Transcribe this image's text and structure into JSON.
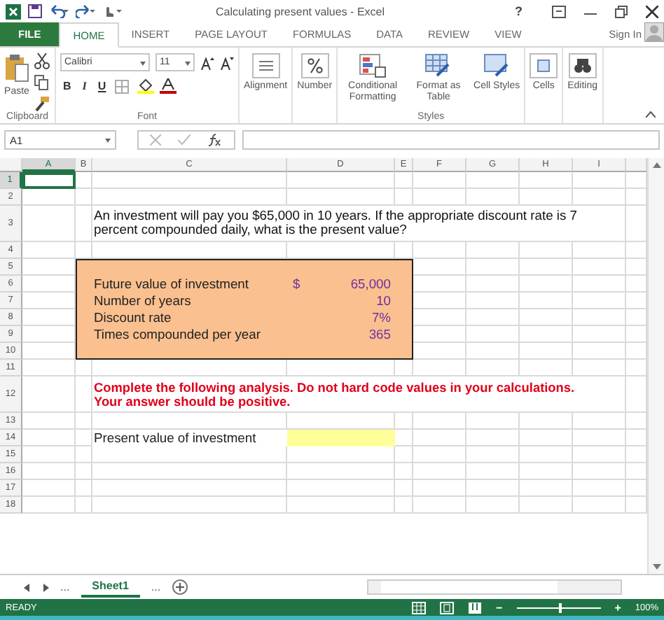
{
  "window": {
    "title": "Calculating present values - Excel",
    "help": "?",
    "sign_in": "Sign In"
  },
  "ribbon_tabs": [
    {
      "label": "FILE",
      "kind": "file",
      "selected": false
    },
    {
      "label": "HOME",
      "kind": "tab",
      "selected": true
    },
    {
      "label": "INSERT",
      "kind": "tab",
      "selected": false
    },
    {
      "label": "PAGE LAYOUT",
      "kind": "tab",
      "selected": false
    },
    {
      "label": "FORMULAS",
      "kind": "tab",
      "selected": false
    },
    {
      "label": "DATA",
      "kind": "tab",
      "selected": false
    },
    {
      "label": "REVIEW",
      "kind": "tab",
      "selected": false
    },
    {
      "label": "VIEW",
      "kind": "tab",
      "selected": false
    }
  ],
  "ribbon": {
    "clipboard": {
      "paste": "Paste",
      "label": "Clipboard"
    },
    "font": {
      "family": "Calibri",
      "size": "11",
      "format_buttons": [
        "B",
        "I",
        "U"
      ],
      "label": "Font"
    },
    "commands": [
      {
        "label": "Alignment",
        "kind": "alignment"
      },
      {
        "label": "Number",
        "kind": "number"
      }
    ],
    "styles": {
      "items": [
        {
          "label": "Conditional Formatting",
          "kind": "conditional"
        },
        {
          "label": "Format as Table",
          "kind": "table"
        },
        {
          "label": "Cell Styles",
          "kind": "cellstyles"
        }
      ],
      "label": "Styles"
    },
    "end_commands": [
      {
        "label": "Cells",
        "kind": "cells"
      },
      {
        "label": "Editing",
        "kind": "editing"
      }
    ]
  },
  "name_box": "A1",
  "sheet": {
    "columns": [
      {
        "label": "A",
        "selected": true
      },
      {
        "label": "B",
        "selected": false
      },
      {
        "label": "C",
        "selected": false
      },
      {
        "label": "D",
        "selected": false
      },
      {
        "label": "E",
        "selected": false
      },
      {
        "label": "F",
        "selected": false
      },
      {
        "label": "G",
        "selected": false
      },
      {
        "label": "H",
        "selected": false
      },
      {
        "label": "I",
        "selected": false
      }
    ],
    "rows": [
      {
        "label": "1",
        "selected": true
      },
      {
        "label": "2",
        "selected": false
      },
      {
        "label": "3",
        "selected": false
      },
      {
        "label": "4",
        "selected": false
      },
      {
        "label": "5",
        "selected": false
      },
      {
        "label": "6",
        "selected": false
      },
      {
        "label": "7",
        "selected": false
      },
      {
        "label": "8",
        "selected": false
      },
      {
        "label": "9",
        "selected": false
      },
      {
        "label": "10",
        "selected": false
      },
      {
        "label": "11",
        "selected": false
      },
      {
        "label": "12",
        "selected": false
      },
      {
        "label": "13",
        "selected": false
      },
      {
        "label": "14",
        "selected": false
      },
      {
        "label": "15",
        "selected": false
      },
      {
        "label": "16",
        "selected": false
      },
      {
        "label": "17",
        "selected": false
      },
      {
        "label": "18",
        "selected": false
      }
    ],
    "question": "An investment will pay you $65,000 in 10 years. If the appropriate discount rate is 7 percent compounded daily, what is the present value?",
    "inputs": [
      {
        "label": "Future value of investment",
        "currency": "$",
        "value": "65,000"
      },
      {
        "label": "Number of years",
        "value": "10"
      },
      {
        "label": "Discount rate",
        "value": "7%"
      },
      {
        "label": "Times compounded per year",
        "value": "365"
      }
    ],
    "instructions": "Complete the following analysis. Do not hard code values in your calculations. Your answer should be positive.",
    "answer": {
      "label": "Present value of investment"
    }
  },
  "sheet_tabs": {
    "more_before": "...",
    "tabs": [
      {
        "label": "Sheet1",
        "selected": true
      }
    ],
    "more_after": "..."
  },
  "status_bar": {
    "status": "READY",
    "zoom_out": "−",
    "zoom_slider": {
      "level": 0.5
    },
    "zoom_in": "+",
    "zoom": "100%"
  }
}
